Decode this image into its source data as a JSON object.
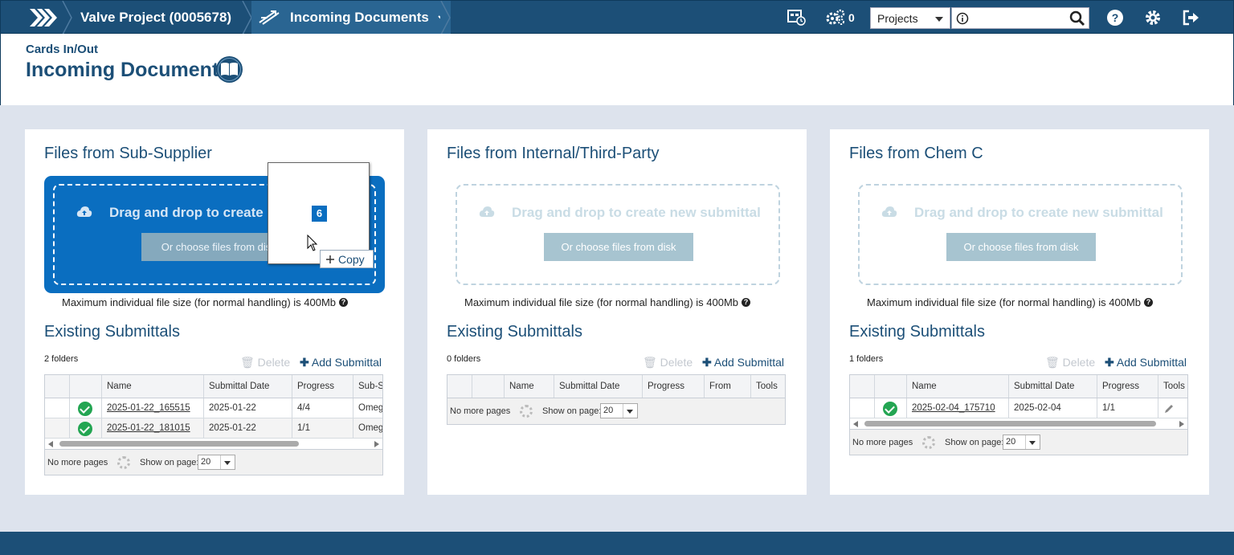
{
  "topbar": {
    "project_crumb": "Valve Project (0005678)",
    "module_crumb": "Incoming Documents",
    "jobs_count": "0",
    "search_scope": "Projects",
    "search_placeholder": ""
  },
  "header": {
    "subtitle": "Cards In/Out",
    "title": "Incoming Documents"
  },
  "common": {
    "dropzone_text": "Drag and drop to create new submittal",
    "choose_label": "Or choose files from disk",
    "max_note": "Maximum individual file size (for normal handling) is 400Mb",
    "help_mark": "?",
    "existing_title": "Existing Submittals",
    "delete_label": "Delete",
    "add_label": "Add Submittal",
    "no_more_pages": "No more pages",
    "show_on_page": "Show on page:",
    "page_size": "20"
  },
  "panels": [
    {
      "title": "Files from Sub-Supplier",
      "dropzone_text_visible": "Drag and drop to create n",
      "choose_label_visible": "Or choose files from dis",
      "folders": "2 folders",
      "columns": [
        "Name",
        "Submittal Date",
        "Progress",
        "Sub-Su"
      ],
      "rows": [
        {
          "name": "2025-01-22_165515",
          "date": "2025-01-22",
          "progress": "4/4",
          "extra": "Omeg"
        },
        {
          "name": "2025-01-22_181015",
          "date": "2025-01-22",
          "progress": "1/1",
          "extra": "Omeg"
        }
      ]
    },
    {
      "title": "Files from Internal/Third-Party",
      "folders": "0 folders",
      "columns": [
        "Name",
        "Submittal Date",
        "Progress",
        "From",
        "Tools"
      ],
      "rows": []
    },
    {
      "title": "Files from Chem C",
      "folders": "1 folders",
      "columns": [
        "Name",
        "Submittal Date",
        "Progress",
        "Tools"
      ],
      "rows": [
        {
          "name": "2025-02-04_175710",
          "date": "2025-02-04",
          "progress": "1/1"
        }
      ]
    }
  ],
  "drag": {
    "count": "6",
    "copy_label": "Copy"
  },
  "colors": {
    "brand": "#1c4f77",
    "drop_active": "#0a6ec0",
    "success": "#23a552"
  }
}
